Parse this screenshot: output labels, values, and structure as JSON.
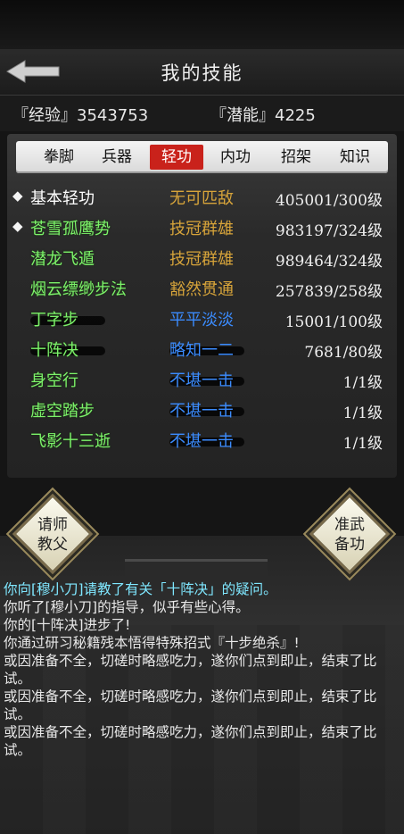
{
  "header": {
    "title": "我的技能",
    "back_icon": "back-arrow-icon"
  },
  "stats": {
    "experience": "『经验』3543753",
    "potential": "『潜能』4225"
  },
  "tabs": [
    {
      "label": "拳脚",
      "active": false
    },
    {
      "label": "兵器",
      "active": false
    },
    {
      "label": "轻功",
      "active": true
    },
    {
      "label": "内功",
      "active": false
    },
    {
      "label": "招架",
      "active": false
    },
    {
      "label": "知识",
      "active": false
    }
  ],
  "skills": [
    {
      "name": "基本轻功",
      "rank": "无可匹敌",
      "level": "405001/300级"
    },
    {
      "name": "苍雪孤鹰势",
      "rank": "技冠群雄",
      "level": "983197/324级"
    },
    {
      "name": "潜龙飞遁",
      "rank": "技冠群雄",
      "level": "989464/324级"
    },
    {
      "name": "烟云缥缈步法",
      "rank": "豁然贯通",
      "level": "257839/258级"
    },
    {
      "name": "丁字步",
      "rank": "平平淡淡",
      "level": "15001/100级"
    },
    {
      "name": "十阵决",
      "rank": "略知一二",
      "level": "7681/80级"
    },
    {
      "name": "身空行",
      "rank": "不堪一击",
      "level": "1/1级"
    },
    {
      "name": "虚空踏步",
      "rank": "不堪一击",
      "level": "1/1级"
    },
    {
      "name": "飞影十三逝",
      "rank": "不堪一击",
      "level": "1/1级"
    }
  ],
  "rank_colors": {
    "gold": "#d7a43a",
    "blue": "#3b8cff",
    "name_green": "#7cf26a",
    "accent_red": "#c9221b"
  },
  "buttons": {
    "ask_teacher": [
      "请师",
      "教父"
    ],
    "prepare_skill": [
      "准武",
      "备功"
    ]
  },
  "log": [
    "你向[穆小刀]请教了有关「十阵决」的疑问。",
    "你听了[穆小刀]的指导，似乎有些心得。",
    "你的[十阵决]进步了!",
    "你通过研习秘籍残本悟得特殊招式『十步绝杀』!",
    "或因准备不全，切磋时略感吃力，遂你们点到即止，结束了比试。",
    "或因准备不全，切磋时略感吃力，遂你们点到即止，结束了比试。",
    "或因准备不全，切磋时略感吃力，遂你们点到即止，结束了比试。"
  ]
}
